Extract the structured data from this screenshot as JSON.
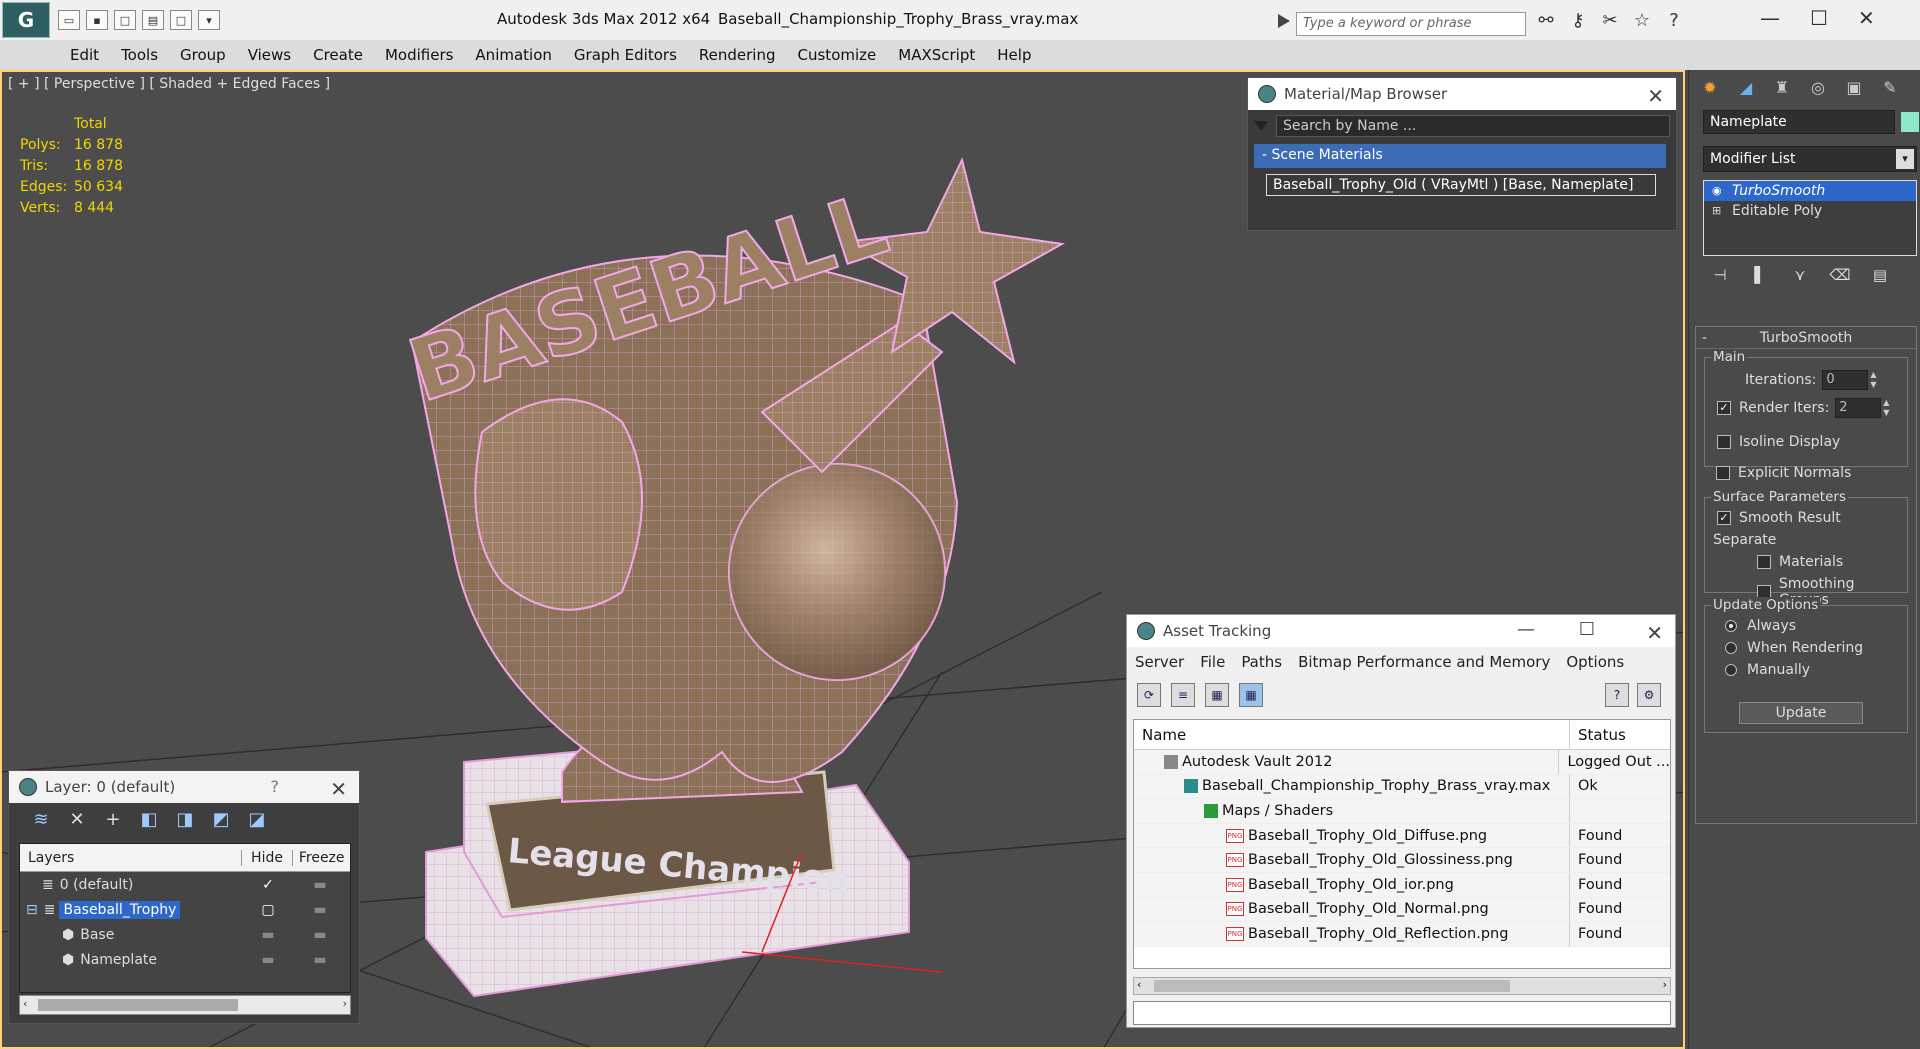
{
  "titlebar": {
    "app_title": "Autodesk 3ds Max  2012 x64",
    "file_title": "Baseball_Championship_Trophy_Brass_vray.max",
    "search_placeholder": "Type a keyword or phrase",
    "logo_icon": "3dsmax-logo-icon",
    "quick_access_icons": [
      "open-icon",
      "save-icon",
      "new-icon",
      "undo-icon",
      "redo-icon",
      "dropdown-icon"
    ],
    "tool_icons": [
      "binoculars-icon",
      "key-icon",
      "communication-icon",
      "star-icon",
      "help-icon"
    ]
  },
  "menubar": {
    "items": [
      "Edit",
      "Tools",
      "Group",
      "Views",
      "Create",
      "Modifiers",
      "Animation",
      "Graph Editors",
      "Rendering",
      "Customize",
      "MAXScript",
      "Help"
    ]
  },
  "viewport": {
    "label": "[ + ] [ Perspective ] [ Shaded + Edged Faces ]",
    "stats": {
      "header": "Total",
      "rows": [
        {
          "k": "Polys:",
          "v": "16 878"
        },
        {
          "k": "Tris:",
          "v": "16 878"
        },
        {
          "k": "Edges:",
          "v": "50 634"
        },
        {
          "k": "Verts:",
          "v": "8 444"
        }
      ]
    },
    "model_text": "BASEBALL",
    "nameplate_text": "League Champion"
  },
  "material_browser": {
    "title": "Material/Map Browser",
    "search_placeholder": "Search by Name ...",
    "section": "- Scene Materials",
    "item": "Baseball_Trophy_Old  ( VRayMtl ) [Base, Nameplate]"
  },
  "asset_tracking": {
    "title": "Asset Tracking",
    "menu": [
      "Server",
      "File",
      "Paths",
      "Bitmap Performance and Memory",
      "Options"
    ],
    "col_name": "Name",
    "col_status": "Status",
    "rows": [
      {
        "name": "Autodesk Vault 2012",
        "status": "Logged Out ...",
        "indent": 0,
        "icon": "vault-icon"
      },
      {
        "name": "Baseball_Championship_Trophy_Brass_vray.max",
        "status": "Ok",
        "indent": 1,
        "icon": "max-file-icon"
      },
      {
        "name": "Maps / Shaders",
        "status": "",
        "indent": 2,
        "icon": "maps-icon"
      },
      {
        "name": "Baseball_Trophy_Old_Diffuse.png",
        "status": "Found",
        "indent": 3,
        "icon": "png-icon"
      },
      {
        "name": "Baseball_Trophy_Old_Glossiness.png",
        "status": "Found",
        "indent": 3,
        "icon": "png-icon"
      },
      {
        "name": "Baseball_Trophy_Old_ior.png",
        "status": "Found",
        "indent": 3,
        "icon": "png-icon"
      },
      {
        "name": "Baseball_Trophy_Old_Normal.png",
        "status": "Found",
        "indent": 3,
        "icon": "png-icon"
      },
      {
        "name": "Baseball_Trophy_Old_Reflection.png",
        "status": "Found",
        "indent": 3,
        "icon": "png-icon"
      }
    ],
    "png_label": "PNG"
  },
  "layer_dialog": {
    "title": "Layer: 0 (default)",
    "help": "?",
    "col_layers": "Layers",
    "col_hide": "Hide",
    "col_freeze": "Freeze",
    "rows": [
      {
        "name": "0 (default)",
        "indent": 1,
        "selected": false,
        "check": "✓"
      },
      {
        "name": "Baseball_Trophy",
        "indent": 1,
        "selected": true,
        "check": "▢"
      },
      {
        "name": "Base",
        "indent": 2,
        "selected": false,
        "check": ""
      },
      {
        "name": "Nameplate",
        "indent": 2,
        "selected": false,
        "check": ""
      }
    ],
    "dash": "▬"
  },
  "command_panel": {
    "object_name": "Nameplate",
    "object_color": "#8ee8cc",
    "modifier_list": "Modifier List",
    "stack": [
      "TurboSmooth",
      "Editable Poly"
    ],
    "rollout_title": "TurboSmooth",
    "main_label": "Main",
    "iterations_label": "Iterations:",
    "iterations_value": "0",
    "render_iters_label": "Render Iters:",
    "render_iters_value": "2",
    "render_iters_checked": true,
    "isoline_label": "Isoline Display",
    "explicit_normals_label": "Explicit Normals",
    "surface_label": "Surface Parameters",
    "smooth_result_label": "Smooth Result",
    "separate_label": "Separate",
    "materials_label": "Materials",
    "smoothing_groups_label": "Smoothing Groups",
    "update_options_label": "Update Options",
    "always_label": "Always",
    "when_rendering_label": "When Rendering",
    "manually_label": "Manually",
    "update_button": "Update"
  },
  "colors": {
    "wire": "#f2a8e6",
    "brass": "#8a7158",
    "stats_yellow": "#f2d600",
    "selection_blue": "#2d67c9"
  }
}
